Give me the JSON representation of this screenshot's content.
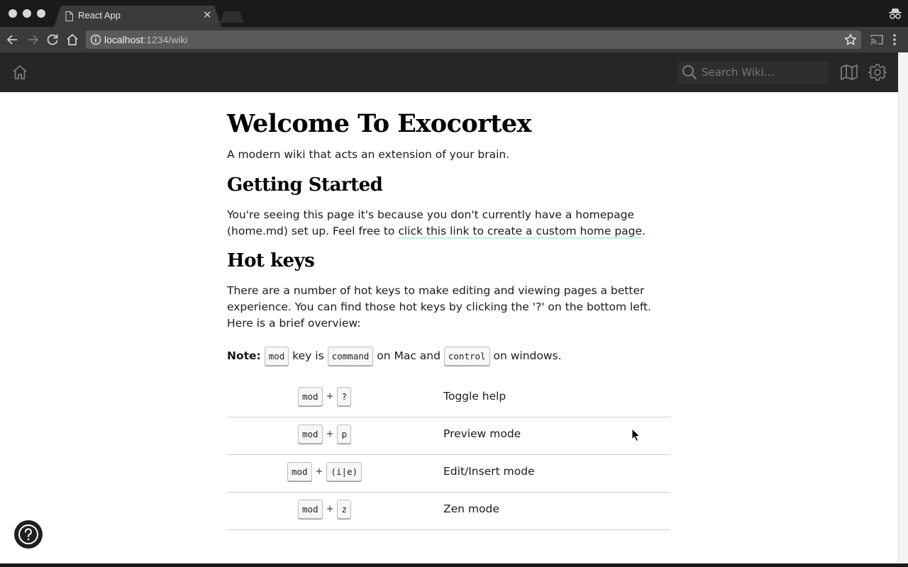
{
  "browser": {
    "tab": {
      "title": "React App"
    },
    "address": {
      "host": "localhost",
      "path": ":1234/wiki"
    }
  },
  "header": {
    "search": {
      "placeholder": "Search Wiki..."
    }
  },
  "page": {
    "title": "Welcome To Exocortex",
    "tagline": "A modern wiki that acts an extension of your brain.",
    "getting_started": {
      "heading": "Getting Started",
      "text_before": "You're seeing this page it's because you don't currently have a homepage (home.md) set up. Feel free to ",
      "link": "click this link to create a custom home page",
      "text_after": "."
    },
    "hot_keys": {
      "heading": "Hot keys",
      "intro": "There are a number of hot keys to make editing and viewing pages a better experience. You can find those hot keys by clicking the '?' on the bottom left. Here is a brief overview:",
      "note": {
        "label": "Note:",
        "key1": "mod",
        "text1": "key is",
        "key2": "command",
        "text2": "on Mac and",
        "key3": "control",
        "text3": "on windows."
      },
      "rows": [
        {
          "mod": "mod",
          "plus": "+",
          "key": "?",
          "desc": "Toggle help"
        },
        {
          "mod": "mod",
          "plus": "+",
          "key": "p",
          "desc": "Preview mode"
        },
        {
          "mod": "mod",
          "plus": "+",
          "key": "(i|e)",
          "desc": "Edit/Insert mode"
        },
        {
          "mod": "mod",
          "plus": "+",
          "key": "z",
          "desc": "Zen mode"
        }
      ]
    }
  },
  "colors": {
    "header_bg": "#262626",
    "link_underline": "#c6edf3",
    "help_button": "#1f1f1f"
  },
  "icons": [
    "document-icon",
    "close-icon",
    "incognito-icon",
    "back-icon",
    "forward-icon",
    "reload-icon",
    "home-icon",
    "info-icon",
    "star-icon",
    "cast-icon",
    "menu-icon",
    "search-icon",
    "map-icon",
    "gear-icon",
    "help-icon"
  ]
}
